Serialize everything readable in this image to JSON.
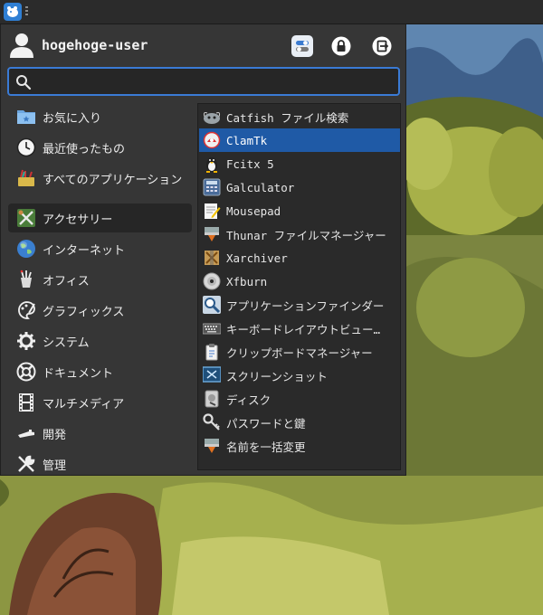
{
  "user": {
    "name": "hogehoge-user"
  },
  "search": {
    "value": "",
    "placeholder": ""
  },
  "header_icons": [
    "settings-icon",
    "lock-icon",
    "logout-icon"
  ],
  "categories": [
    {
      "label": "お気に入り",
      "icon": "favorites-folder-icon"
    },
    {
      "label": "最近使ったもの",
      "icon": "clock-icon"
    },
    {
      "label": "すべてのアプリケーション",
      "icon": "all-apps-icon"
    },
    {
      "label": "アクセサリー",
      "icon": "accessories-icon",
      "active": true
    },
    {
      "label": "インターネット",
      "icon": "globe-icon"
    },
    {
      "label": "オフィス",
      "icon": "office-icon"
    },
    {
      "label": "グラフィックス",
      "icon": "graphics-palette-icon"
    },
    {
      "label": "システム",
      "icon": "system-gear-icon"
    },
    {
      "label": "ドキュメント",
      "icon": "help-lifebuoy-icon"
    },
    {
      "label": "マルチメディア",
      "icon": "multimedia-film-icon"
    },
    {
      "label": "開発",
      "icon": "development-icon"
    },
    {
      "label": "管理",
      "icon": "admin-tools-icon"
    }
  ],
  "apps": [
    {
      "label": "Catfish ファイル検索",
      "icon": "catfish-icon"
    },
    {
      "label": "ClamTk",
      "icon": "clamtk-icon",
      "selected": true
    },
    {
      "label": "Fcitx 5",
      "icon": "penguin-icon"
    },
    {
      "label": "Galculator",
      "icon": "calculator-icon"
    },
    {
      "label": "Mousepad",
      "icon": "text-editor-icon"
    },
    {
      "label": "Thunar ファイルマネージャー",
      "icon": "file-manager-icon"
    },
    {
      "label": "Xarchiver",
      "icon": "archiver-icon"
    },
    {
      "label": "Xfburn",
      "icon": "disc-icon"
    },
    {
      "label": "アプリケーションファインダー",
      "icon": "magnifier-icon"
    },
    {
      "label": "キーボードレイアウトビュー…",
      "icon": "keyboard-icon"
    },
    {
      "label": "クリップボードマネージャー",
      "icon": "clipboard-icon"
    },
    {
      "label": "スクリーンショット",
      "icon": "screenshot-icon"
    },
    {
      "label": "ディスク",
      "icon": "disk-icon"
    },
    {
      "label": "パスワードと鍵",
      "icon": "keys-icon"
    },
    {
      "label": "名前を一括変更",
      "icon": "bulk-rename-icon"
    }
  ],
  "colors": {
    "menu_bg": "#363636",
    "apps_bg": "#2a2a2a",
    "selection": "#1f5aa6",
    "search_border": "#3a7bd5"
  }
}
